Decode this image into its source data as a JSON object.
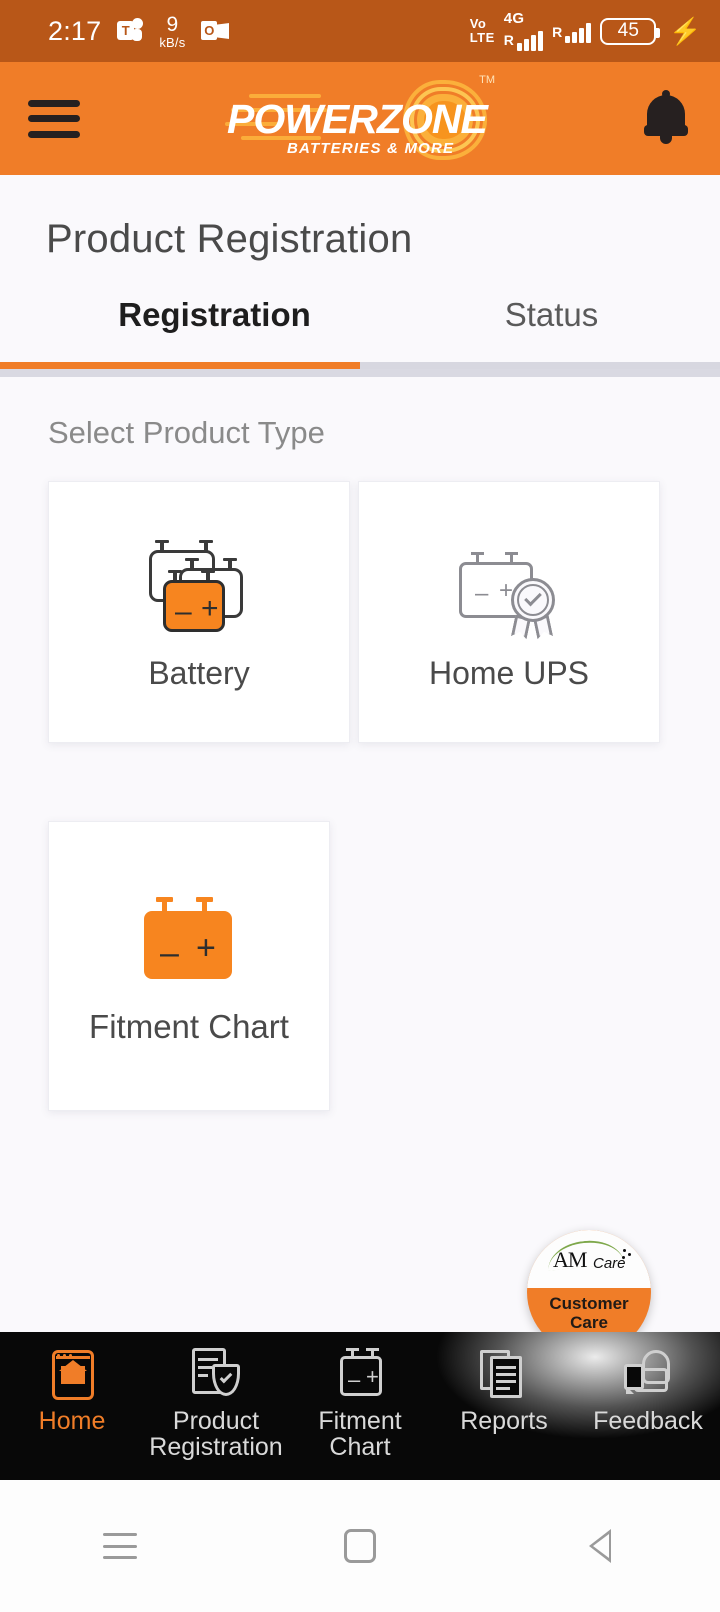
{
  "status_bar": {
    "time": "2:17",
    "network_speed_value": "9",
    "network_speed_unit": "kB/s",
    "teams_icon": "teams-icon",
    "outlook_icon": "outlook-icon",
    "volte_line1": "Vo",
    "volte_line2": "LTE",
    "network_type": "4G",
    "roaming_sim1": "R",
    "roaming_sim2": "R",
    "battery_level": "45",
    "charging_icon": "charging-bolt-icon",
    "background_color": "#B85718"
  },
  "app_bar": {
    "menu_icon": "hamburger-menu-icon",
    "logo_primary": "POWER",
    "logo_secondary": "ZONE",
    "logo_tagline": "BATTERIES & MORE",
    "logo_tm": "TM",
    "notification_icon": "bell-icon",
    "background_color": "#F07D28"
  },
  "page": {
    "title": "Product Registration",
    "tabs": [
      {
        "label": "Registration",
        "active": true
      },
      {
        "label": "Status",
        "active": false
      }
    ],
    "accent_color": "#F07D28"
  },
  "main": {
    "section_label": "Select Product Type",
    "cards": [
      {
        "label": "Battery",
        "icon": "battery-stack-icon"
      },
      {
        "label": "Home UPS",
        "icon": "battery-certificate-icon"
      },
      {
        "label": "Fitment Chart",
        "icon": "battery-solid-icon"
      }
    ],
    "battery_symbols": {
      "minus": "–",
      "plus": "+"
    }
  },
  "fab": {
    "logo_text": "AM",
    "logo_suffix": "Care",
    "line1": "Customer",
    "line2": "Care",
    "background_color": "#F07D28",
    "swoosh_color": "#7EA84B"
  },
  "bottom_nav": {
    "items": [
      {
        "label": "Home",
        "icon": "home-icon",
        "active": true
      },
      {
        "label_line1": "Product",
        "label_line2": "Registration",
        "icon": "document-shield-icon",
        "active": false
      },
      {
        "label_line1": "Fitment",
        "label_line2": "Chart",
        "icon": "battery-outline-icon",
        "active": false
      },
      {
        "label": "Reports",
        "icon": "reports-pages-icon",
        "active": false
      },
      {
        "label": "Feedback",
        "icon": "thumbs-up-icon",
        "active": false
      }
    ],
    "active_color": "#F07D28",
    "background_color": "#080808"
  },
  "system_nav": {
    "recents_icon": "recents-icon",
    "home_icon": "system-home-icon",
    "back_icon": "back-icon"
  }
}
